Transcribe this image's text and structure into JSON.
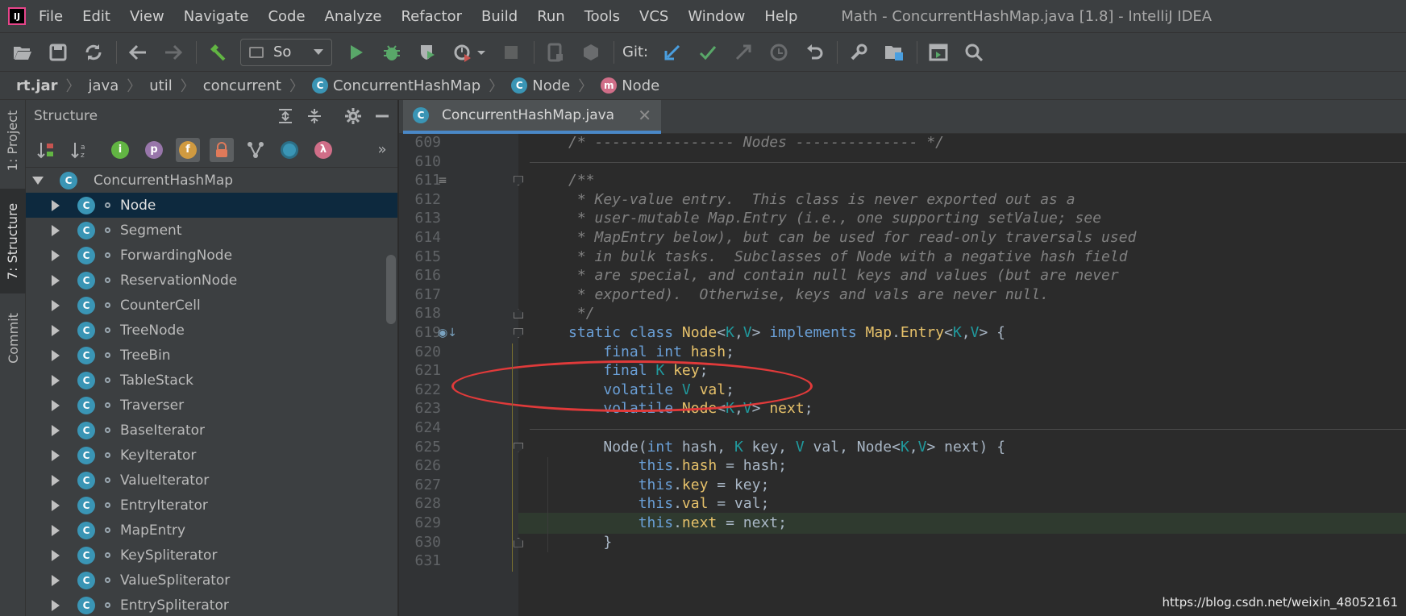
{
  "app": {
    "logo_text": "IJ",
    "window_title": "Math - ConcurrentHashMap.java [1.8] - IntelliJ IDEA"
  },
  "menu": [
    "File",
    "Edit",
    "View",
    "Navigate",
    "Code",
    "Analyze",
    "Refactor",
    "Build",
    "Run",
    "Tools",
    "VCS",
    "Window",
    "Help"
  ],
  "toolbar": {
    "run_config": "So",
    "git_label": "Git:",
    "icons": [
      "open-icon",
      "save-icon",
      "sync-icon",
      "back-icon",
      "forward-icon",
      "build-hammer-icon",
      "run-icon",
      "debug-icon",
      "coverage-icon",
      "profile-icon",
      "stop-icon",
      "device-icon",
      "package-icon",
      "vcs-update-icon",
      "vcs-commit-icon",
      "vcs-push-icon",
      "history-icon",
      "rollback-icon",
      "settings-wrench-icon",
      "project-structure-icon",
      "presentation-icon",
      "search-icon"
    ]
  },
  "breadcrumb": {
    "items": [
      {
        "label": "rt.jar",
        "badge": ""
      },
      {
        "label": "java",
        "badge": ""
      },
      {
        "label": "util",
        "badge": ""
      },
      {
        "label": "concurrent",
        "badge": ""
      },
      {
        "label": "ConcurrentHashMap",
        "badge": "C"
      },
      {
        "label": "Node",
        "badge": "C"
      },
      {
        "label": "Node",
        "badge": "m"
      }
    ]
  },
  "tool_strip": {
    "project": "1: Project",
    "structure": "7: Structure",
    "commit": "Commit"
  },
  "structure_panel": {
    "title": "Structure",
    "toolbar_badges": {
      "inherited": "i",
      "properties": "p",
      "fields": "f",
      "lambda": "λ"
    },
    "root": "ConcurrentHashMap",
    "items": [
      "Node",
      "Segment",
      "ForwardingNode",
      "ReservationNode",
      "CounterCell",
      "TreeNode",
      "TreeBin",
      "TableStack",
      "Traverser",
      "BaseIterator",
      "KeyIterator",
      "ValueIterator",
      "EntryIterator",
      "MapEntry",
      "KeySpliterator",
      "ValueSpliterator",
      "EntrySpliterator"
    ],
    "selected_index": 0
  },
  "editor": {
    "tab_label": "ConcurrentHashMap.java",
    "tab_badge": "C",
    "close_glyph": "✕",
    "current_line": "629",
    "lines": [
      {
        "n": "609",
        "text": "/* ---------------- Nodes -------------- */"
      },
      {
        "n": "610",
        "text": ""
      },
      {
        "n": "611",
        "text": "/**"
      },
      {
        "n": "612",
        "text": " * Key-value entry.  This class is never exported out as a"
      },
      {
        "n": "613",
        "text": " * user-mutable Map.Entry (i.e., one supporting setValue; see"
      },
      {
        "n": "614",
        "text": " * MapEntry below), but can be used for read-only traversals used"
      },
      {
        "n": "615",
        "text": " * in bulk tasks.  Subclasses of Node with a negative hash field"
      },
      {
        "n": "616",
        "text": " * are special, and contain null keys and values (but are never"
      },
      {
        "n": "617",
        "text": " * exported).  Otherwise, keys and vals are never null."
      },
      {
        "n": "618",
        "text": " */"
      },
      {
        "n": "619",
        "text": "static class Node<K,V> implements Map.Entry<K,V> {"
      },
      {
        "n": "620",
        "text": "    final int hash;"
      },
      {
        "n": "621",
        "text": "    final K key;"
      },
      {
        "n": "622",
        "text": "    volatile V val;"
      },
      {
        "n": "623",
        "text": "    volatile Node<K,V> next;"
      },
      {
        "n": "624",
        "text": ""
      },
      {
        "n": "625",
        "text": "    Node(int hash, K key, V val, Node<K,V> next) {"
      },
      {
        "n": "626",
        "text": "        this.hash = hash;"
      },
      {
        "n": "627",
        "text": "        this.key = key;"
      },
      {
        "n": "628",
        "text": "        this.val = val;"
      },
      {
        "n": "629",
        "text": "        this.next = next;"
      },
      {
        "n": "630",
        "text": "    }"
      },
      {
        "n": "631",
        "text": ""
      }
    ]
  },
  "watermark": "https://blog.csdn.net/weixin_48052161",
  "colors": {
    "background": "#2b2b2b",
    "chrome": "#3c3f41",
    "keyword": "#6a9fd6",
    "type": "#e6c16a",
    "type_param": "#20999d",
    "field": "#9876aa",
    "comment": "#808080",
    "annotation_ellipse": "#e03a3a",
    "selection": "#0d293e"
  }
}
